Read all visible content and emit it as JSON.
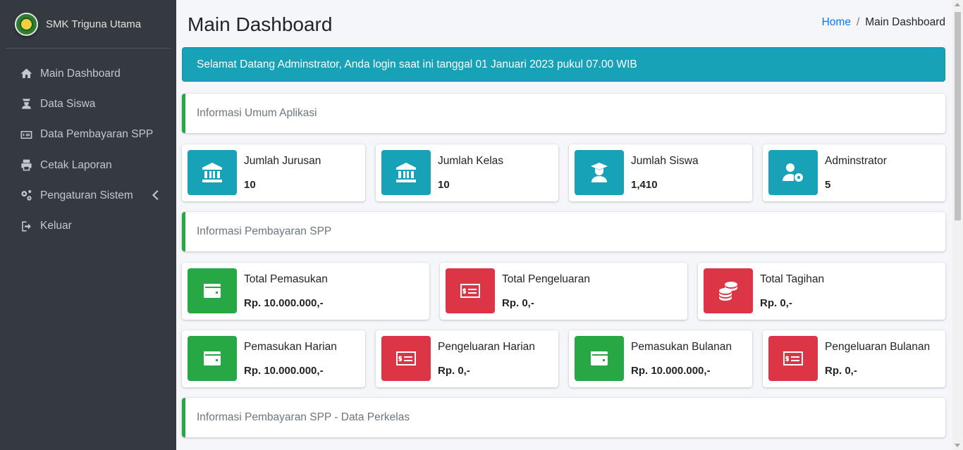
{
  "brand": {
    "name": "SMK Triguna Utama"
  },
  "sidebar": {
    "items": [
      {
        "label": "Main Dashboard",
        "icon": "home-icon"
      },
      {
        "label": "Data Siswa",
        "icon": "student-icon"
      },
      {
        "label": "Data Pembayaran SPP",
        "icon": "money-bill-icon"
      },
      {
        "label": "Cetak Laporan",
        "icon": "print-icon"
      },
      {
        "label": "Pengaturan Sistem",
        "icon": "cogs-icon"
      },
      {
        "label": "Keluar",
        "icon": "sign-out-icon"
      }
    ]
  },
  "header": {
    "title": "Main Dashboard",
    "breadcrumb": {
      "home": "Home",
      "separator": "/",
      "current": "Main Dashboard"
    }
  },
  "alert": {
    "text": "Selamat Datang Adminstrator, Anda login saat ini tanggal 01 Januari 2023 pukul 07.00 WIB"
  },
  "sections": {
    "umum": "Informasi Umum Aplikasi",
    "spp": "Informasi Pembayaran SPP",
    "perkelas": "Informasi Pembayaran SPP - Data Perkelas"
  },
  "stats_umum": [
    {
      "label": "Jumlah Jurusan",
      "value": "10",
      "icon": "university-icon"
    },
    {
      "label": "Jumlah Kelas",
      "value": "10",
      "icon": "university-icon"
    },
    {
      "label": "Jumlah Siswa",
      "value": "1,410",
      "icon": "user-graduate-icon"
    },
    {
      "label": "Adminstrator",
      "value": "5",
      "icon": "users-cog-icon"
    }
  ],
  "stats_spp_totals": [
    {
      "label": "Total Pemasukan",
      "value": "Rp. 10.000.000,-",
      "icon": "wallet-icon"
    },
    {
      "label": "Total Pengeluaran",
      "value": "Rp. 0,-",
      "icon": "money-check-icon"
    },
    {
      "label": "Total Tagihan",
      "value": "Rp. 0,-",
      "icon": "coins-icon"
    }
  ],
  "stats_spp_periodic": [
    {
      "label": "Pemasukan Harian",
      "value": "Rp. 10.000.000,-",
      "icon": "wallet-icon"
    },
    {
      "label": "Pengeluaran Harian",
      "value": "Rp. 0,-",
      "icon": "money-check-icon"
    },
    {
      "label": "Pemasukan Bulanan",
      "value": "Rp. 10.000.000,-",
      "icon": "wallet-icon"
    },
    {
      "label": "Pengeluaran Bulanan",
      "value": "Rp. 0,-",
      "icon": "money-check-icon"
    }
  ],
  "colors": {
    "sidebar_bg": "#343a40",
    "info": "#17a2b8",
    "success": "#28a745",
    "danger": "#dc3545"
  }
}
